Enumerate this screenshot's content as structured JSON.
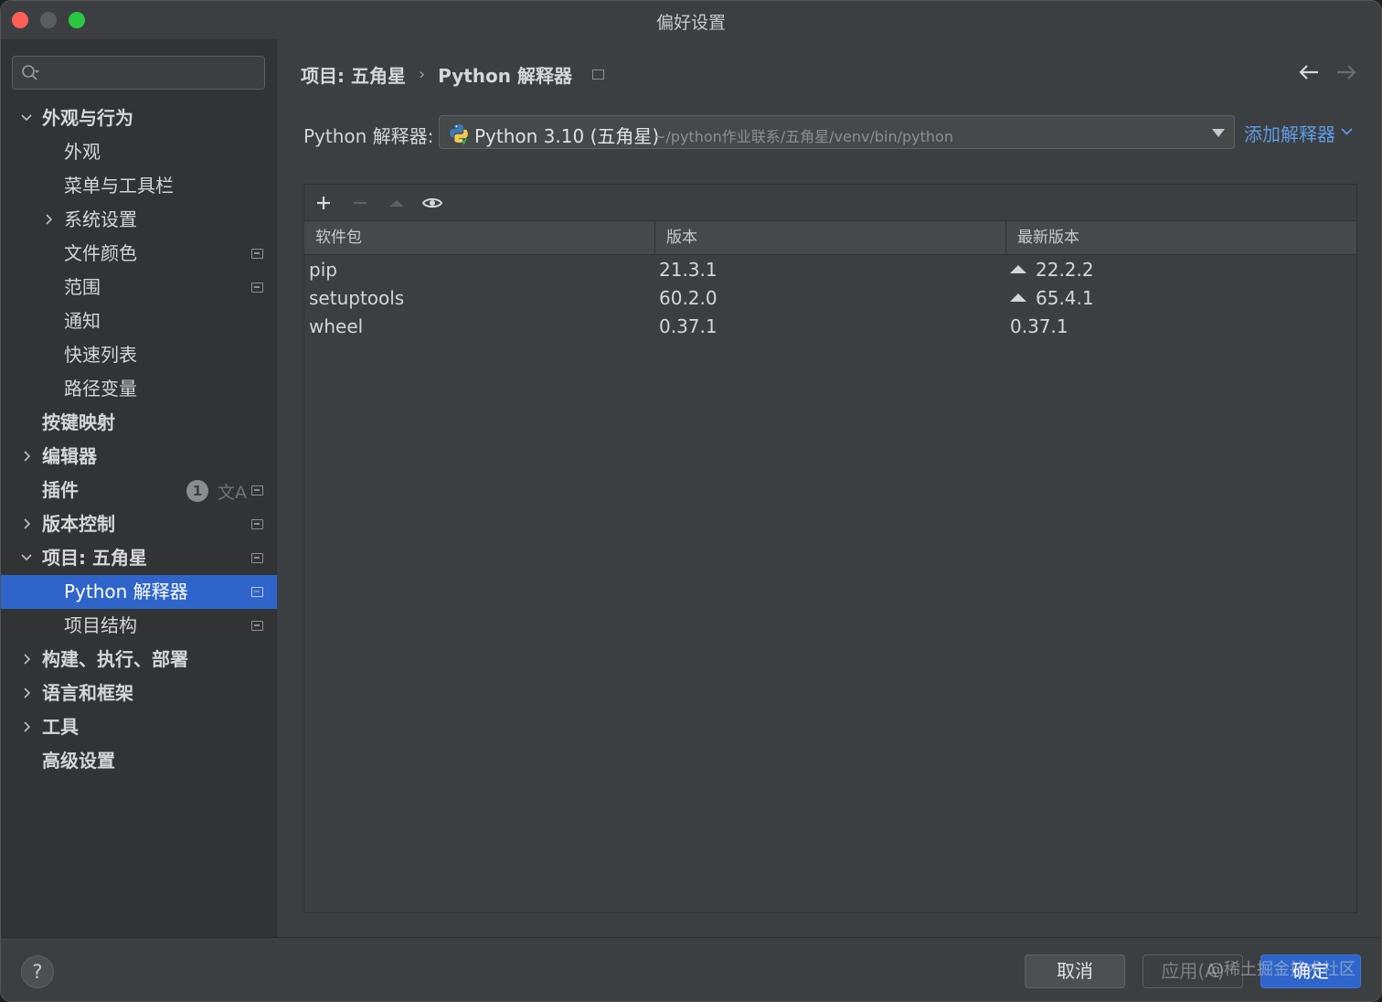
{
  "window": {
    "title": "偏好设置"
  },
  "search": {
    "placeholder": ""
  },
  "sidebar": {
    "items": [
      {
        "label": "外观与行为",
        "expanded": true
      },
      {
        "label": "外观"
      },
      {
        "label": "菜单与工具栏"
      },
      {
        "label": "系统设置",
        "expandable": true
      },
      {
        "label": "文件颜色"
      },
      {
        "label": "范围"
      },
      {
        "label": "通知"
      },
      {
        "label": "快速列表"
      },
      {
        "label": "路径变量"
      },
      {
        "label": "按键映射"
      },
      {
        "label": "编辑器",
        "expandable": true
      },
      {
        "label": "插件",
        "badge_count": "1"
      },
      {
        "label": "版本控制",
        "expandable": true
      },
      {
        "label": "项目: 五角星",
        "expanded": true
      },
      {
        "label": "Python 解释器",
        "selected": true
      },
      {
        "label": "项目结构"
      },
      {
        "label": "构建、执行、部署",
        "expandable": true
      },
      {
        "label": "语言和框架",
        "expandable": true
      },
      {
        "label": "工具",
        "expandable": true
      },
      {
        "label": "高级设置"
      }
    ],
    "plugins_translate_icon": "文A"
  },
  "breadcrumb": {
    "project": "项目: 五角星",
    "separator": "›",
    "page": "Python 解释器"
  },
  "interpreter": {
    "label": "Python 解释器:",
    "name": "Python 3.10 (五角星)",
    "path": "~/python作业联系/五角星/venv/bin/python",
    "add_label": "添加解释器"
  },
  "packages": {
    "columns": [
      "软件包",
      "版本",
      "最新版本"
    ],
    "rows": [
      {
        "name": "pip",
        "version": "21.3.1",
        "latest": "22.2.2",
        "upgrade": true
      },
      {
        "name": "setuptools",
        "version": "60.2.0",
        "latest": "65.4.1",
        "upgrade": true
      },
      {
        "name": "wheel",
        "version": "0.37.1",
        "latest": "0.37.1",
        "upgrade": false
      }
    ]
  },
  "footer": {
    "help": "?",
    "cancel": "取消",
    "apply": "应用(A)",
    "ok": "确定",
    "watermark": "@稀土掘金技术社区"
  },
  "colors": {
    "accent": "#2f65ca",
    "link": "#5e9ce6",
    "background": "#3c3f41",
    "sidebar": "#313335"
  }
}
